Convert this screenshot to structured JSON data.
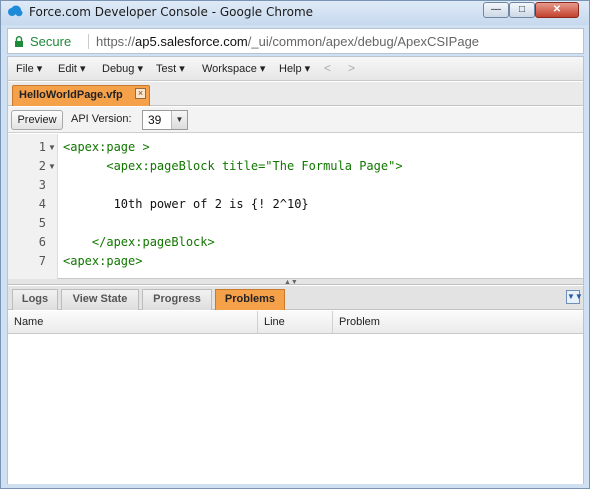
{
  "window": {
    "title": "Force.com Developer Console - Google Chrome",
    "controls": {
      "minimize": "—",
      "maximize": "□",
      "close": "✕"
    }
  },
  "address_bar": {
    "secure_label": "Secure",
    "url_scheme": "https://",
    "url_host": "ap5.salesforce.com",
    "url_path": "/_ui/common/apex/debug/ApexCSIPage"
  },
  "menu": {
    "items": [
      "File ▾",
      "Edit ▾",
      "Debug ▾",
      "Test ▾",
      "Workspace ▾",
      "Help ▾"
    ],
    "back": "<",
    "forward": ">"
  },
  "editor_tab": {
    "label": "HelloWorldPage.vfp",
    "close": "×"
  },
  "toolbar": {
    "preview_label": "Preview",
    "api_version_label": "API Version:",
    "api_version_value": "39"
  },
  "code": {
    "line_numbers": [
      "1",
      "2",
      "3",
      "4",
      "5",
      "6",
      "7"
    ],
    "lines": [
      "<apex:page >",
      "      <apex:pageBlock title=\"The Formula Page\">",
      "",
      "       10th power of 2 is {! 2^10}",
      "",
      "    </apex:pageBlock>",
      "<apex:page>"
    ]
  },
  "bottom_panel": {
    "tabs": [
      "Logs",
      "View State",
      "Progress",
      "Problems"
    ],
    "active_tab": "Problems",
    "columns": [
      "Name",
      "Line",
      "Problem"
    ]
  },
  "colors": {
    "active_tab": "#f5a14a",
    "secure_green": "#1d8a3a",
    "tag_green": "#117700",
    "string_red": "#aa1111"
  }
}
